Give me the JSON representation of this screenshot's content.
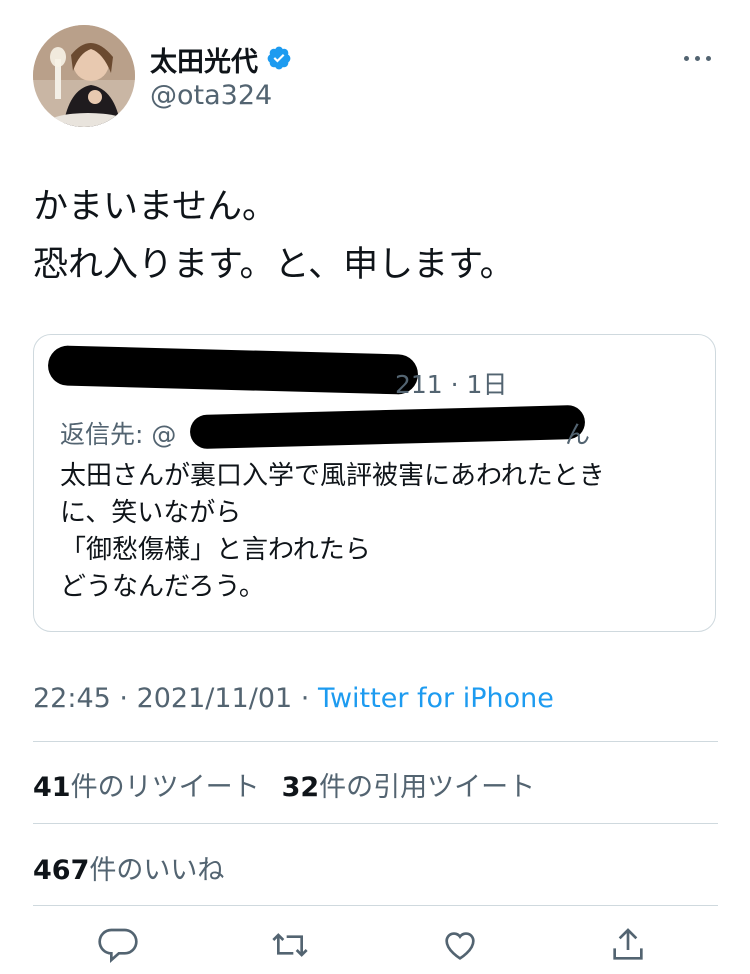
{
  "author": {
    "display_name": "太田光代",
    "handle": "@ota324",
    "verified": true
  },
  "tweet": {
    "lines": [
      "かまいません。",
      "恐れ入ります。と、申します。"
    ]
  },
  "quoted": {
    "meta_visible": "211 · 1日",
    "reply_prefix": "返信先: @",
    "reply_suffix": "ん",
    "body_lines": [
      "太田さんが裏口入学で風評被害にあわれたとき",
      "に、笑いながら",
      "「御愁傷様」と言われたら",
      "どうなんだろう。"
    ]
  },
  "meta": {
    "time": "22:45",
    "date": "2021/11/01",
    "separator": " · ",
    "source": "Twitter for iPhone"
  },
  "stats": {
    "retweets_count": "41",
    "retweets_label": "件のリツイート",
    "quotes_count": "32",
    "quotes_label": "件の引用ツイート",
    "likes_count": "467",
    "likes_label": "件のいいね"
  },
  "colors": {
    "verified": "#1d9bf0",
    "link": "#1d9bf0",
    "muted": "#536471",
    "text": "#0f1419"
  },
  "icons": [
    "more-icon",
    "verified-badge-icon",
    "reply-icon",
    "retweet-icon",
    "like-icon",
    "share-icon"
  ]
}
